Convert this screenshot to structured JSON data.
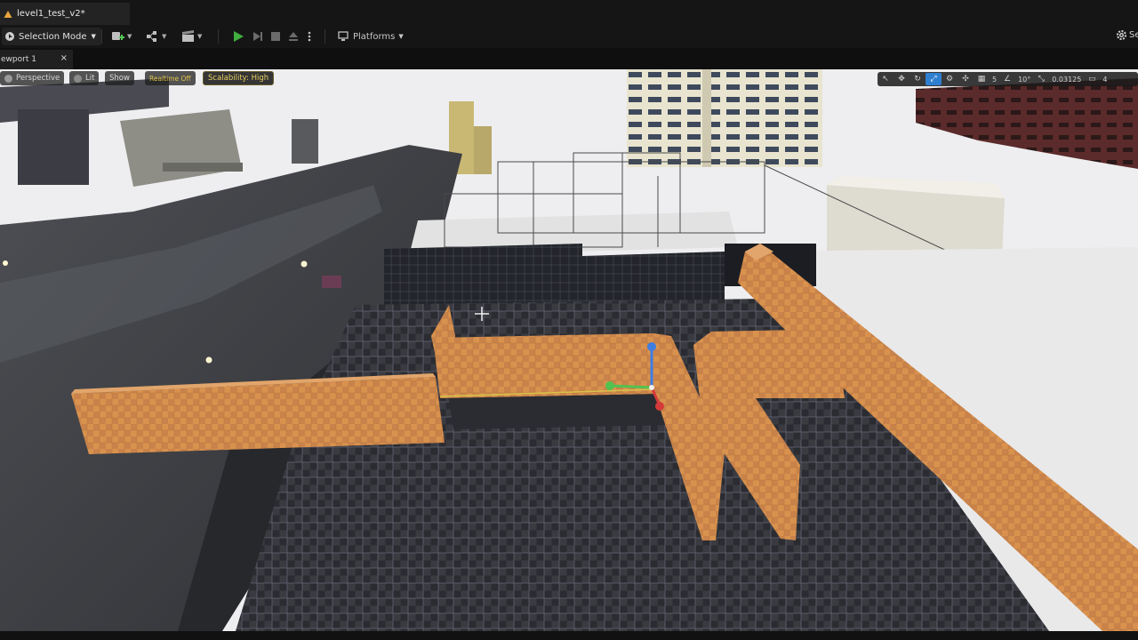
{
  "document_tab": {
    "title": "level1_test_v2*"
  },
  "toolbar": {
    "mode_label": "Selection Mode",
    "platforms_label": "Platforms",
    "settings_label": "Se"
  },
  "viewport_tab": {
    "label": "ewport 1",
    "close": "×"
  },
  "viewport": {
    "perspective_label": "Perspective",
    "lit_label": "Lit",
    "show_label": "Show",
    "realtime_label": "Realtime Off",
    "scalability_label": "Scalability: High",
    "grid_snap": "5",
    "rotation_snap": "10°",
    "scale_snap": "0.03125",
    "camera_speed": "4"
  },
  "colors": {
    "accent": "#2f7fd1",
    "play_green": "#3fae3f",
    "brick_orange": "#d9924e"
  }
}
